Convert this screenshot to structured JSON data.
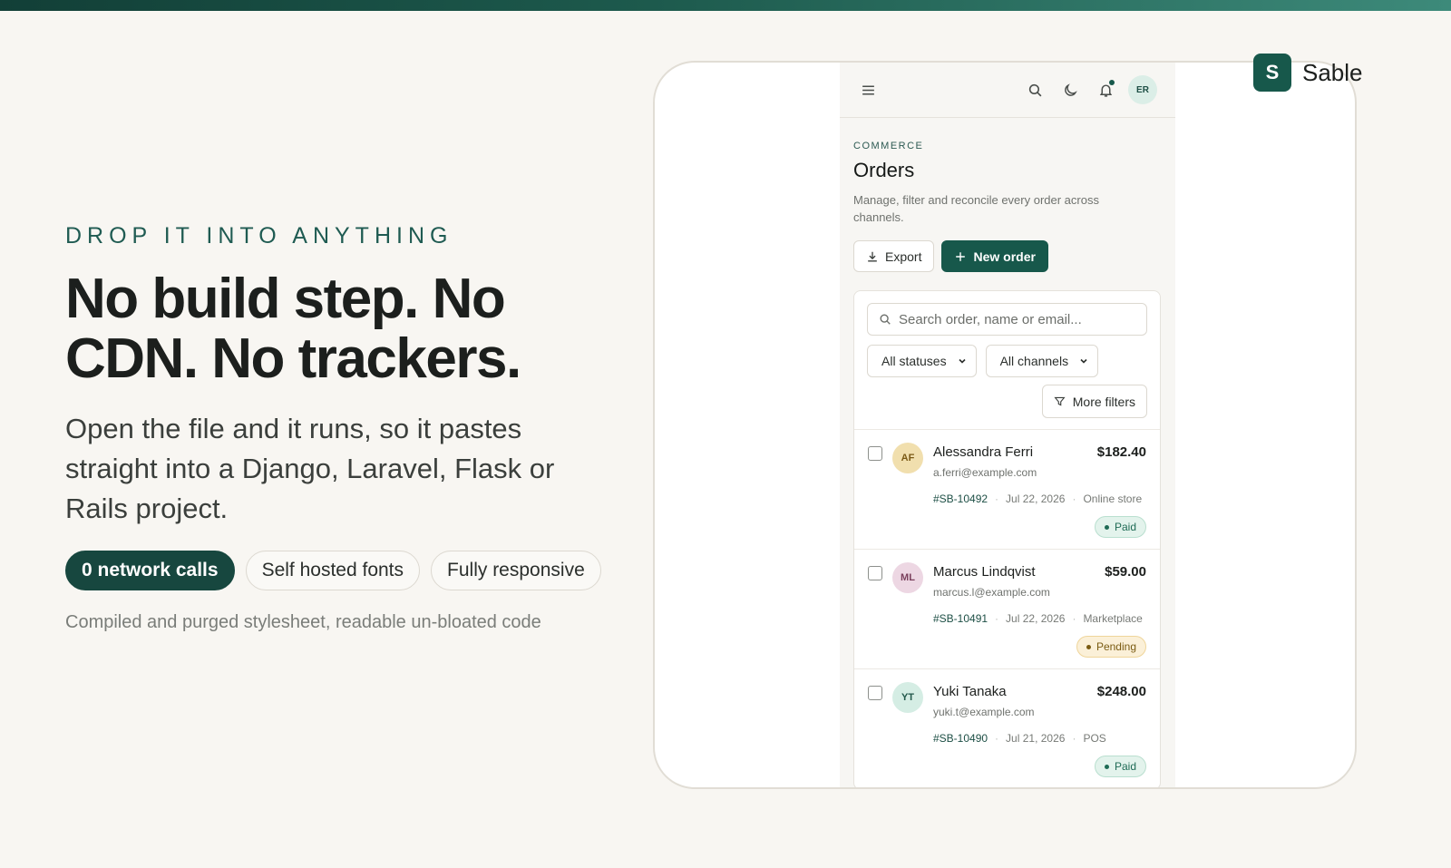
{
  "hero": {
    "eyebrow": "DROP IT INTO ANYTHING",
    "headline_line1": "No build step. No",
    "headline_line2": "CDN. No trackers.",
    "lede": "Open the file and it runs, so it pastes straight into a Django, Laravel, Flask or Rails project.",
    "pills": [
      "0 network calls",
      "Self hosted fonts",
      "Fully responsive"
    ],
    "footnote": "Compiled and purged stylesheet, readable un-bloated code"
  },
  "brand": {
    "mark": "S",
    "name": "Sable"
  },
  "app": {
    "user_initials": "ER",
    "breadcrumb": "COMMERCE",
    "title": "Orders",
    "description": "Manage, filter and reconcile every order across channels.",
    "export_label": "Export",
    "new_order_label": "New order",
    "search_placeholder": "Search order, name or email...",
    "status_filter": "All statuses",
    "channel_filter": "All channels",
    "more_filters_label": "More filters",
    "orders": [
      {
        "initials": "AF",
        "name": "Alessandra Ferri",
        "email": "a.ferri@example.com",
        "amount": "$182.40",
        "id": "#SB-10492",
        "date": "Jul 22, 2026",
        "channel": "Online store",
        "status": "Paid",
        "avatar_bg": "#f1dfae",
        "avatar_fg": "#7b5a16"
      },
      {
        "initials": "ML",
        "name": "Marcus Lindqvist",
        "email": "marcus.l@example.com",
        "amount": "$59.00",
        "id": "#SB-10491",
        "date": "Jul 22, 2026",
        "channel": "Marketplace",
        "status": "Pending",
        "avatar_bg": "#edd7e3",
        "avatar_fg": "#7a3f5c"
      },
      {
        "initials": "YT",
        "name": "Yuki Tanaka",
        "email": "yuki.t@example.com",
        "amount": "$248.00",
        "id": "#SB-10490",
        "date": "Jul 21, 2026",
        "channel": "POS",
        "status": "Paid",
        "avatar_bg": "#d5ede4",
        "avatar_fg": "#23584b"
      }
    ]
  },
  "colors": {
    "accent": "#17584b",
    "paid_bg": "#e3f3ec",
    "paid_fg": "#1f6b55",
    "paid_border": "#b9dfcf",
    "pending_bg": "#fbf0d8",
    "pending_fg": "#7a5b12",
    "pending_border": "#efd59a"
  }
}
